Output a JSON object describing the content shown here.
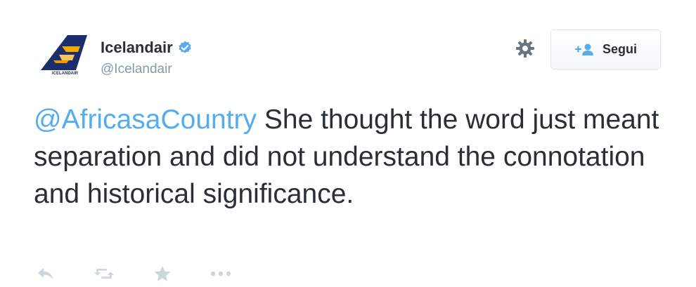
{
  "author": {
    "name": "Icelandair",
    "handle": "@Icelandair",
    "verified": true,
    "avatar_text": "ICELANDAIR"
  },
  "header": {
    "follow_label": "Segui",
    "settings_icon": "gear-icon",
    "follow_icon": "add-user-icon"
  },
  "tweet": {
    "mention": "@AfricasaCountry",
    "text": " She thought the word just meant separation and did not understand the connotation and historical significance."
  },
  "actions": [
    {
      "icon": "reply-icon"
    },
    {
      "icon": "retweet-icon"
    },
    {
      "icon": "favorite-star-icon"
    },
    {
      "icon": "more-options-icon"
    }
  ],
  "colors": {
    "link": "#55acee",
    "text": "#292f33",
    "muted": "#8899a6",
    "action": "#ccd6dd",
    "brand_navy": "#1c2d6b",
    "brand_gold": "#f2a900",
    "verified": "#55acee"
  }
}
